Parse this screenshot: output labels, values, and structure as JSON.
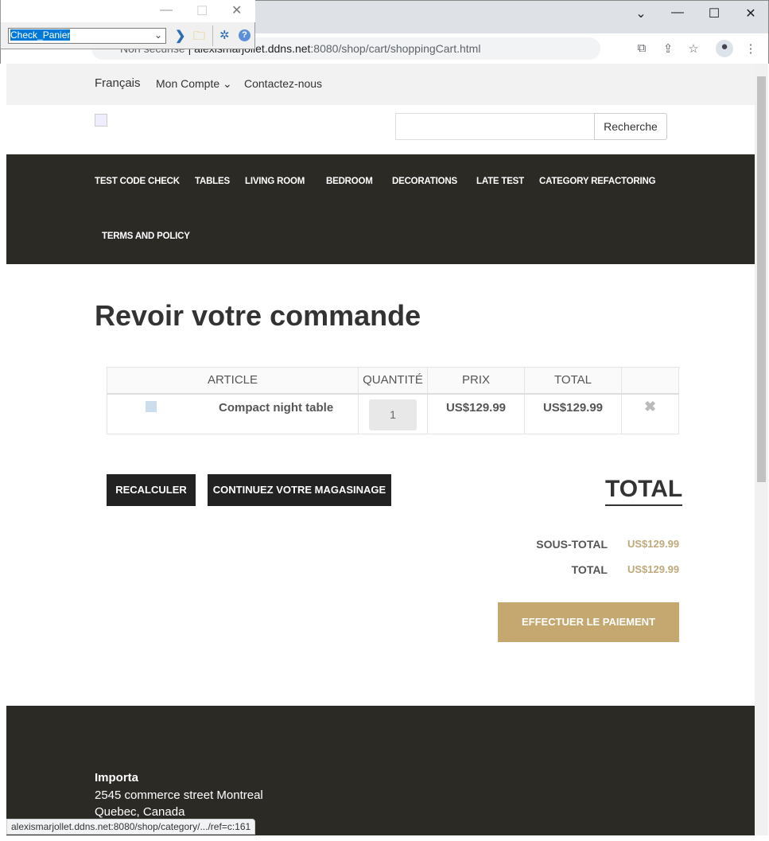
{
  "browser": {
    "security": "Non sécurisé",
    "url_host": "alexismarjollet.ddns.net",
    "url_path": ":8080/shop/cart/shoppingCart.html",
    "status_url": "alexismarjollet.ddns.net:8080/shop/category/.../ref=c:161"
  },
  "tool": {
    "script": "Check_Panier"
  },
  "topnav": {
    "language": "Français",
    "account": "Mon Compte",
    "contact": "Contactez-nous"
  },
  "search": {
    "button": "Recherche",
    "value": ""
  },
  "categories": [
    "TEST CODE CHECK",
    "TABLES",
    "LIVING ROOM",
    "BEDROOM",
    "DECORATIONS",
    "LATE TEST",
    "CATEGORY REFACTORING",
    "TERMS AND POLICY"
  ],
  "page_title": "Revoir votre commande",
  "cart": {
    "headers": [
      "ARTICLE",
      "QUANTITÉ",
      "PRIX",
      "TOTAL"
    ],
    "items": [
      {
        "name": "Compact night table",
        "quantity": "1",
        "price": "US$129.99",
        "total": "US$129.99"
      }
    ]
  },
  "buttons": {
    "recalc": "RECALCULER",
    "continue": "CONTINUEZ VOTRE MAGASINAGE",
    "checkout": "EFFECTUER LE PAIEMENT"
  },
  "summary": {
    "heading": "TOTAL",
    "subtotal_label": "SOUS-TOTAL",
    "subtotal": "US$129.99",
    "total_label": "TOTAL",
    "total": "US$129.99"
  },
  "footer": {
    "company": "Importa",
    "address1": "2545 commerce street Montreal",
    "address2": "Quebec, Canada"
  },
  "colors": {
    "dark": "#2c2a25",
    "accent": "#c4a86f"
  }
}
